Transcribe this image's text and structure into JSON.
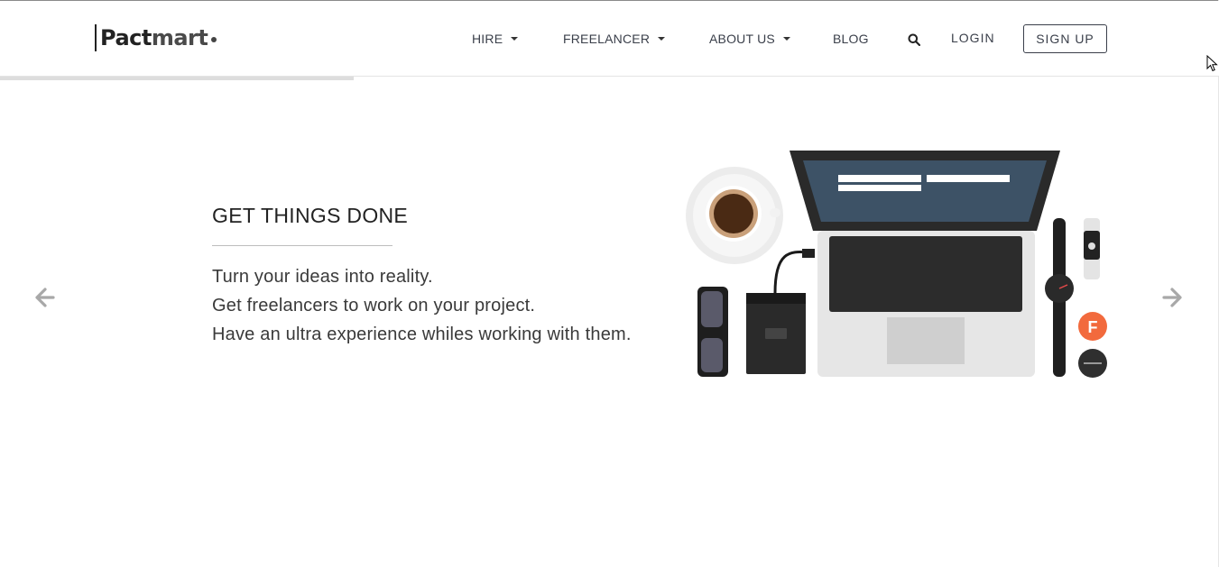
{
  "header": {
    "logo": {
      "brand_main": "Pact",
      "brand_rest": "mart"
    },
    "nav": [
      {
        "label": "HIRE",
        "has_dropdown": true
      },
      {
        "label": "FREELANCER",
        "has_dropdown": true
      },
      {
        "label": "ABOUT US",
        "has_dropdown": true
      },
      {
        "label": "BLOG",
        "has_dropdown": false
      }
    ],
    "search_icon": "search-icon",
    "login_label": "LOGIN",
    "signup_label": "SIGN UP"
  },
  "slider": {
    "progress": 0.29,
    "title": "GET THINGS DONE",
    "lines": [
      "Turn your ideas into reality.",
      "Get freelancers to work on your project.",
      "Have an ultra experience whiles working with them."
    ],
    "prev_icon": "arrow-left-icon",
    "next_icon": "arrow-right-icon",
    "illustration_icon": "workspace-illustration-icon"
  },
  "colors": {
    "accent_orange": "#f26a3d",
    "text_dark": "#222222",
    "nav_text": "#3a3f4a"
  }
}
